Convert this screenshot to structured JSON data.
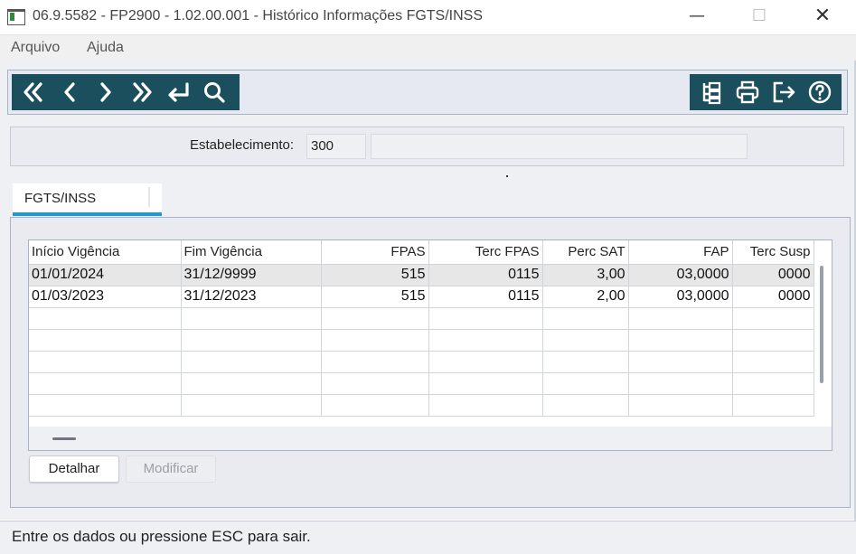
{
  "window": {
    "title": "06.9.5582 - FP2900 - 1.02.00.001 - Histórico Informações FGTS/INSS",
    "controls": {
      "minimize": "—",
      "maximize": "☐",
      "close": "✕"
    }
  },
  "menu": {
    "items": [
      {
        "label": "Arquivo"
      },
      {
        "label": "Ajuda"
      }
    ]
  },
  "toolbar": {
    "left_icons": [
      "first-icon",
      "previous-icon",
      "next-icon",
      "last-icon",
      "goto-icon",
      "search-icon"
    ],
    "right_icons": [
      "structure-icon",
      "print-icon",
      "exit-icon",
      "help-icon"
    ],
    "color": "#1b4f5e"
  },
  "establishment": {
    "label": "Estabelecimento:",
    "code": "300",
    "description": ""
  },
  "tabs": [
    {
      "label": "FGTS/INSS",
      "active": true
    }
  ],
  "grid": {
    "columns": [
      "Início Vigência",
      "Fim Vigência",
      "FPAS",
      "Terc FPAS",
      "Perc SAT",
      "FAP",
      "Terc Susp"
    ],
    "rows": [
      [
        "01/01/2024",
        "31/12/9999",
        "515",
        "0115",
        "3,00",
        "03,0000",
        "0000"
      ],
      [
        "01/03/2023",
        "31/12/2023",
        "515",
        "0115",
        "2,00",
        "03,0000",
        "0000"
      ]
    ],
    "selected_row": 0
  },
  "buttons": {
    "detail": "Detalhar",
    "modify": "Modificar"
  },
  "status": {
    "text": "Entre os dados ou pressione ESC para sair."
  },
  "colors": {
    "accent": "#1a9ad6",
    "toolbar": "#1b4f5e"
  }
}
